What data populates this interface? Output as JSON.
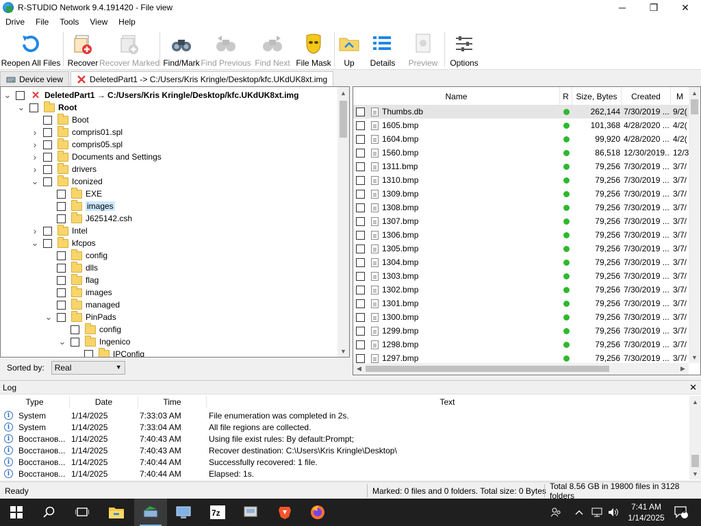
{
  "window": {
    "title": "R-STUDIO Network 9.4.191420 - File view",
    "minimize_glyph": "─",
    "maximize_glyph": "❐",
    "close_glyph": "✕"
  },
  "menu": [
    "Drive",
    "File",
    "Tools",
    "View",
    "Help"
  ],
  "toolbar": {
    "reopen": "Reopen All Files",
    "recover": "Recover",
    "recover_marked": "Recover Marked",
    "find_mark": "Find/Mark",
    "find_previous": "Find Previous",
    "find_next": "Find Next",
    "file_mask": "File Mask",
    "up": "Up",
    "details": "Details",
    "preview": "Preview",
    "options": "Options"
  },
  "tabs": {
    "device_view": "Device view",
    "file_view": "DeletedPart1 -> C:/Users/Kris Kringle/Desktop/kfc.UKdUK8xt.img"
  },
  "tree": {
    "rows": [
      {
        "label": "DeletedPart1 → C:/Users/Kris Kringle/Desktop/kfc.UKdUK8xt.img",
        "level": 0,
        "twist": "open",
        "icon": "deleted",
        "bold": true
      },
      {
        "label": "Root",
        "level": 1,
        "twist": "open",
        "icon": "folder",
        "bold": true
      },
      {
        "label": "Boot",
        "level": 2,
        "twist": "none",
        "icon": "folder"
      },
      {
        "label": "compris01.spl",
        "level": 2,
        "twist": "closed",
        "icon": "folder"
      },
      {
        "label": "compris05.spl",
        "level": 2,
        "twist": "closed",
        "icon": "folder"
      },
      {
        "label": "Documents and Settings",
        "level": 2,
        "twist": "closed",
        "icon": "folder"
      },
      {
        "label": "drivers",
        "level": 2,
        "twist": "closed",
        "icon": "folder"
      },
      {
        "label": "Iconized",
        "level": 2,
        "twist": "open",
        "icon": "folder"
      },
      {
        "label": "EXE",
        "level": 3,
        "twist": "none",
        "icon": "folder"
      },
      {
        "label": "images",
        "level": 3,
        "twist": "none",
        "icon": "folder",
        "selected": true
      },
      {
        "label": "J625142.csh",
        "level": 3,
        "twist": "none",
        "icon": "folder"
      },
      {
        "label": "Intel",
        "level": 2,
        "twist": "closed",
        "icon": "folder"
      },
      {
        "label": "kfcpos",
        "level": 2,
        "twist": "open",
        "icon": "folder"
      },
      {
        "label": "config",
        "level": 3,
        "twist": "none",
        "icon": "folder"
      },
      {
        "label": "dlls",
        "level": 3,
        "twist": "none",
        "icon": "folder"
      },
      {
        "label": "flag",
        "level": 3,
        "twist": "none",
        "icon": "folder"
      },
      {
        "label": "images",
        "level": 3,
        "twist": "none",
        "icon": "folder"
      },
      {
        "label": "managed",
        "level": 3,
        "twist": "none",
        "icon": "folder"
      },
      {
        "label": "PinPads",
        "level": 3,
        "twist": "open",
        "icon": "folder"
      },
      {
        "label": "config",
        "level": 4,
        "twist": "none",
        "icon": "folder"
      },
      {
        "label": "Ingenico",
        "level": 4,
        "twist": "open",
        "icon": "folder"
      },
      {
        "label": "IPConfig",
        "level": 5,
        "twist": "none",
        "icon": "folder"
      }
    ]
  },
  "sort": {
    "label": "Sorted by:",
    "value": "Real"
  },
  "filelist": {
    "columns": {
      "name": "Name",
      "r": "R",
      "size": "Size, Bytes",
      "created": "Created",
      "modified": "M"
    },
    "rows": [
      {
        "name": "Thumbs.db",
        "size": "262,144",
        "created": "7/30/2019 ...",
        "modified": "9/2(",
        "selected": true
      },
      {
        "name": "1605.bmp",
        "size": "101,368",
        "created": "4/28/2020 ...",
        "modified": "4/2("
      },
      {
        "name": "1604.bmp",
        "size": "99,920",
        "created": "4/28/2020 ...",
        "modified": "4/2("
      },
      {
        "name": "1560.bmp",
        "size": "86,518",
        "created": "12/30/2019...",
        "modified": "12/3"
      },
      {
        "name": "1311.bmp",
        "size": "79,256",
        "created": "7/30/2019 ...",
        "modified": "3/7/"
      },
      {
        "name": "1310.bmp",
        "size": "79,256",
        "created": "7/30/2019 ...",
        "modified": "3/7/"
      },
      {
        "name": "1309.bmp",
        "size": "79,256",
        "created": "7/30/2019 ...",
        "modified": "3/7/"
      },
      {
        "name": "1308.bmp",
        "size": "79,256",
        "created": "7/30/2019 ...",
        "modified": "3/7/"
      },
      {
        "name": "1307.bmp",
        "size": "79,256",
        "created": "7/30/2019 ...",
        "modified": "3/7/"
      },
      {
        "name": "1306.bmp",
        "size": "79,256",
        "created": "7/30/2019 ...",
        "modified": "3/7/"
      },
      {
        "name": "1305.bmp",
        "size": "79,256",
        "created": "7/30/2019 ...",
        "modified": "3/7/"
      },
      {
        "name": "1304.bmp",
        "size": "79,256",
        "created": "7/30/2019 ...",
        "modified": "3/7/"
      },
      {
        "name": "1303.bmp",
        "size": "79,256",
        "created": "7/30/2019 ...",
        "modified": "3/7/"
      },
      {
        "name": "1302.bmp",
        "size": "79,256",
        "created": "7/30/2019 ...",
        "modified": "3/7/"
      },
      {
        "name": "1301.bmp",
        "size": "79,256",
        "created": "7/30/2019 ...",
        "modified": "3/7/"
      },
      {
        "name": "1300.bmp",
        "size": "79,256",
        "created": "7/30/2019 ...",
        "modified": "3/7/"
      },
      {
        "name": "1299.bmp",
        "size": "79,256",
        "created": "7/30/2019 ...",
        "modified": "3/7/"
      },
      {
        "name": "1298.bmp",
        "size": "79,256",
        "created": "7/30/2019 ...",
        "modified": "3/7/"
      },
      {
        "name": "1297.bmp",
        "size": "79,256",
        "created": "7/30/2019 ...",
        "modified": "3/7/"
      }
    ]
  },
  "log": {
    "title": "Log",
    "columns": {
      "type": "Type",
      "date": "Date",
      "time": "Time",
      "text": "Text"
    },
    "rows": [
      {
        "type": "System",
        "date": "1/14/2025",
        "time": "7:33:03 AM",
        "text": "File enumeration was completed in 2s."
      },
      {
        "type": "System",
        "date": "1/14/2025",
        "time": "7:33:04 AM",
        "text": "All file regions are collected."
      },
      {
        "type": "Восстанов...",
        "date": "1/14/2025",
        "time": "7:40:43 AM",
        "text": "Using file exist rules: By default:Prompt;"
      },
      {
        "type": "Восстанов...",
        "date": "1/14/2025",
        "time": "7:40:43 AM",
        "text": "Recover destination: C:\\Users\\Kris Kringle\\Desktop\\"
      },
      {
        "type": "Восстанов...",
        "date": "1/14/2025",
        "time": "7:40:44 AM",
        "text": "Successfully recovered: 1 file."
      },
      {
        "type": "Восстанов...",
        "date": "1/14/2025",
        "time": "7:40:44 AM",
        "text": "Elapsed: 1s."
      }
    ]
  },
  "status": {
    "ready": "Ready",
    "marked": "Marked: 0 files and 0 folders. Total size: 0 Bytes",
    "total": "Total 8.56 GB in 19800 files in 3128 folders"
  },
  "taskbar": {
    "apps": [
      "start-icon",
      "search-icon",
      "task-view-icon",
      "file-explorer-icon",
      "r-studio-icon",
      "network-tool-icon",
      "7zip-icon",
      "drive-tool-icon",
      "brave-icon",
      "firefox-icon"
    ],
    "time": "7:41 AM",
    "date": "1/14/2025",
    "notification_count": "5"
  },
  "colors": {
    "accent": "#0078d7",
    "ok_dot": "#2eb82e",
    "taskbar": "#1f1f1f",
    "selection": "#cce8ff"
  }
}
